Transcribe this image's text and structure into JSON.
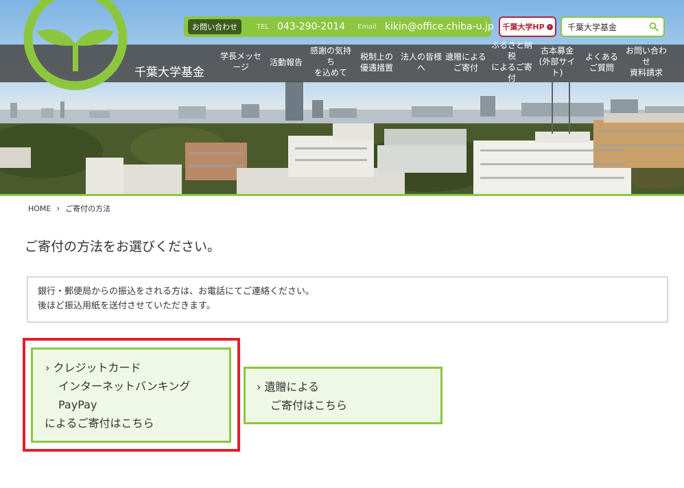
{
  "header": {
    "contact_label": "お問い合わせ",
    "tel_label": "TEL",
    "tel_value": "043-290-2014",
    "email_label": "Email",
    "email_value": "kikin@office.chiba-u.jp",
    "hp_button": "千葉大学HP",
    "search_value": "千葉大学基金",
    "brand": "千葉大学基金"
  },
  "nav": {
    "items": [
      {
        "label": "学長メッセ\nージ"
      },
      {
        "label": "活動報告"
      },
      {
        "label": "感謝の気持\nち\nを込めて"
      },
      {
        "label": "税制上の\n優遇措置"
      },
      {
        "label": "法人の皆様\nへ"
      },
      {
        "label": "遺贈による\nご寄付"
      },
      {
        "label": "ふるさと納\n税\nによるご寄\n付"
      },
      {
        "label": "古本募金\n(外部サイ\nト)"
      },
      {
        "label": "よくある\nご質問"
      },
      {
        "label": "お問い合わ\nせ\n資料請求"
      }
    ]
  },
  "breadcrumb": {
    "home": "HOME",
    "separator": "›",
    "current": "ご寄付の方法"
  },
  "main": {
    "title": "ご寄付の方法をお選びください。",
    "notice_line1": "銀行・郵便局からの振込をされる方は、お電話にてご連絡ください。",
    "notice_line2": "後ほど振込用紙を送付させていただきます。",
    "option_a": {
      "line1": "› クレジットカード",
      "line2": "インターネットバンキング",
      "line3": "PayPay",
      "line4": "によるご寄付はこちら"
    },
    "option_b": {
      "line1": "› 遺贈による",
      "line2": "ご寄付はこちら"
    }
  },
  "colors": {
    "accent_green": "#8cc63f",
    "dark_green": "#3d5b1c",
    "highlight_red": "#e0202b",
    "university_red": "#b0233a"
  }
}
